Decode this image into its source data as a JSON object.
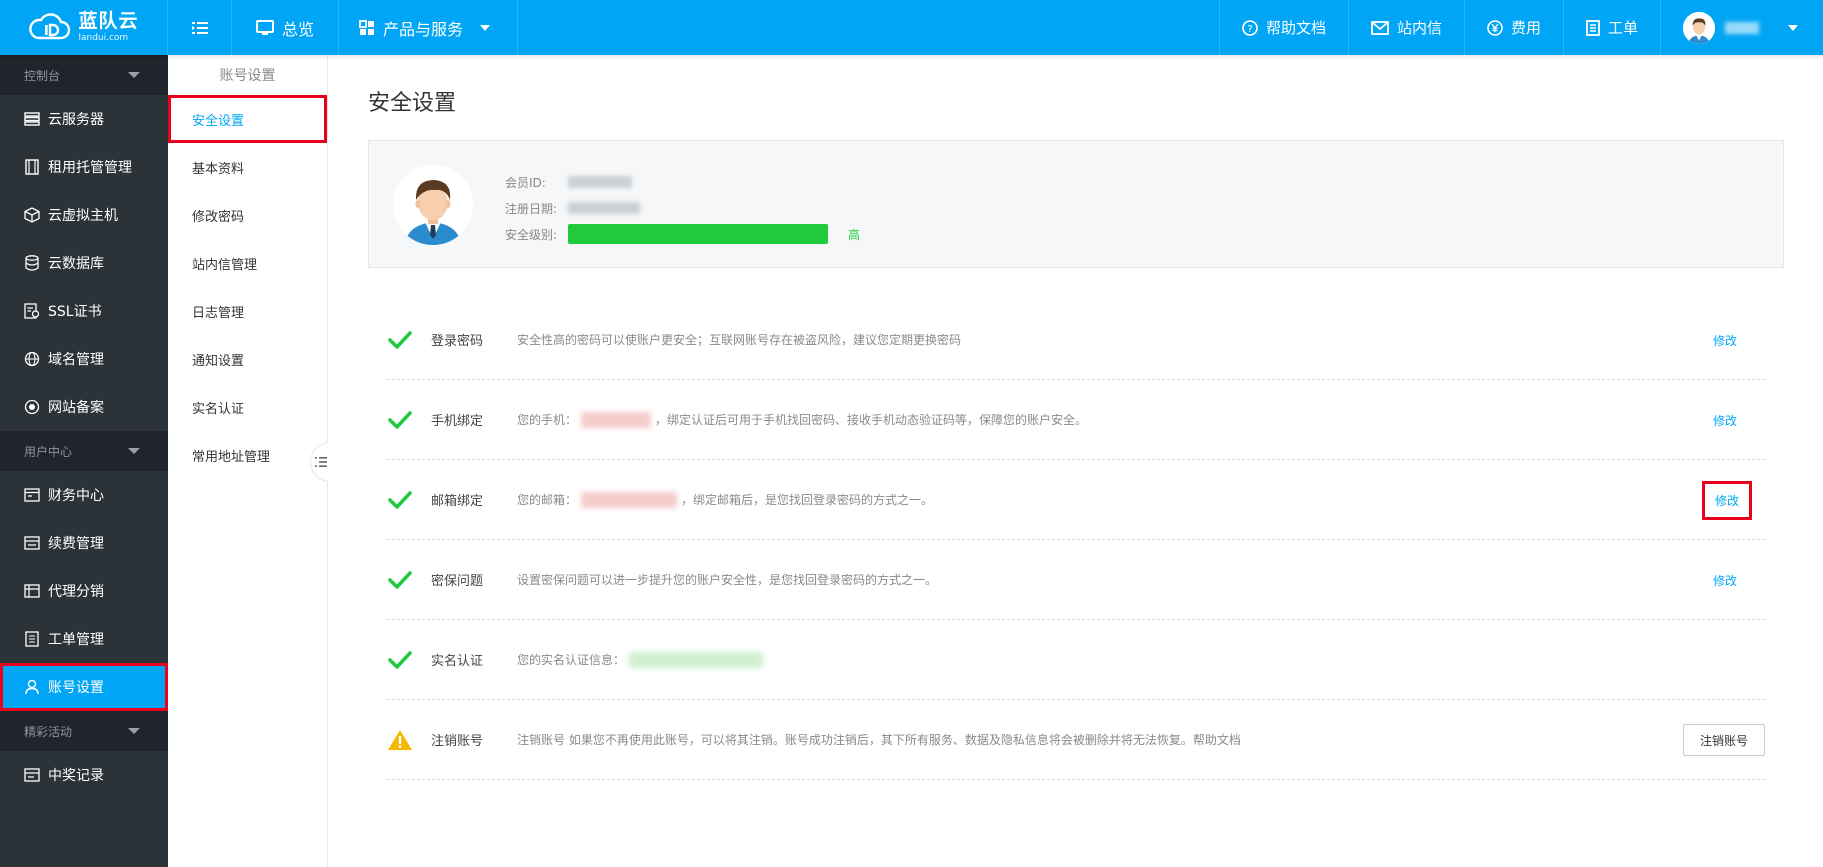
{
  "header": {
    "logo_name": "蓝队云",
    "logo_domain": "landui.com",
    "overview_label": "总览",
    "products_label": "产品与服务",
    "help_docs_label": "帮助文档",
    "messages_label": "站内信",
    "fees_label": "费用",
    "tickets_label": "工单"
  },
  "sidebar": {
    "groups": [
      {
        "label": "控制台"
      },
      {
        "label": "用户中心"
      },
      {
        "label": "精彩活动"
      }
    ],
    "items": [
      {
        "label": "云服务器",
        "icon": "server-icon"
      },
      {
        "label": "租用托管管理",
        "icon": "rack-icon"
      },
      {
        "label": "云虚拟主机",
        "icon": "cube-icon"
      },
      {
        "label": "云数据库",
        "icon": "database-icon"
      },
      {
        "label": "SSL证书",
        "icon": "certificate-icon"
      },
      {
        "label": "域名管理",
        "icon": "globe-icon"
      },
      {
        "label": "网站备案",
        "icon": "record-icon"
      },
      {
        "label": "财务中心",
        "icon": "finance-icon"
      },
      {
        "label": "续费管理",
        "icon": "renew-icon"
      },
      {
        "label": "代理分销",
        "icon": "agent-icon"
      },
      {
        "label": "工单管理",
        "icon": "ticket-icon"
      },
      {
        "label": "账号设置",
        "icon": "user-icon"
      },
      {
        "label": "中奖记录",
        "icon": "prize-icon"
      }
    ]
  },
  "subnav": {
    "title": "账号设置",
    "items": [
      {
        "label": "安全设置"
      },
      {
        "label": "基本资料"
      },
      {
        "label": "修改密码"
      },
      {
        "label": "站内信管理"
      },
      {
        "label": "日志管理"
      },
      {
        "label": "通知设置"
      },
      {
        "label": "实名认证"
      },
      {
        "label": "常用地址管理"
      }
    ]
  },
  "main": {
    "title": "安全设置",
    "profile": {
      "member_id_label": "会员ID:",
      "register_date_label": "注册日期:",
      "security_level_label": "安全级别:",
      "security_level_value": "高",
      "security_level_fraction": 1.0
    },
    "security_items": [
      {
        "name": "登录密码",
        "status": "ok",
        "desc": "安全性高的密码可以使账户更安全；互联网账号存在被盗风险，建议您定期更换密码",
        "action": "修改"
      },
      {
        "name": "手机绑定",
        "status": "ok",
        "desc_prefix": "您的手机：",
        "desc_suffix": "，绑定认证后可用于手机找回密码、接收手机动态验证码等，保障您的账户安全。",
        "action": "修改"
      },
      {
        "name": "邮箱绑定",
        "status": "ok",
        "desc_prefix": "您的邮箱：",
        "desc_suffix": "，绑定邮箱后，是您找回登录密码的方式之一。",
        "action": "修改"
      },
      {
        "name": "密保问题",
        "status": "ok",
        "desc": "设置密保问题可以进一步提升您的账户安全性，是您找回登录密码的方式之一。",
        "action": "修改"
      },
      {
        "name": "实名认证",
        "status": "ok",
        "desc_prefix": "您的实名认证信息："
      },
      {
        "name": "注销账号",
        "status": "warning",
        "desc": "注销账号 如果您不再使用此账号，可以将其注销。账号成功注销后，其下所有服务、数据及隐私信息将会被删除并将无法恢复。帮助文档",
        "action": "注销账号"
      }
    ]
  },
  "colors": {
    "accent": "#00a6f5",
    "sidebar_bg": "#2b3238",
    "success": "#1fcb3c",
    "warning": "#f5b800",
    "highlight_border": "#e8001c"
  }
}
